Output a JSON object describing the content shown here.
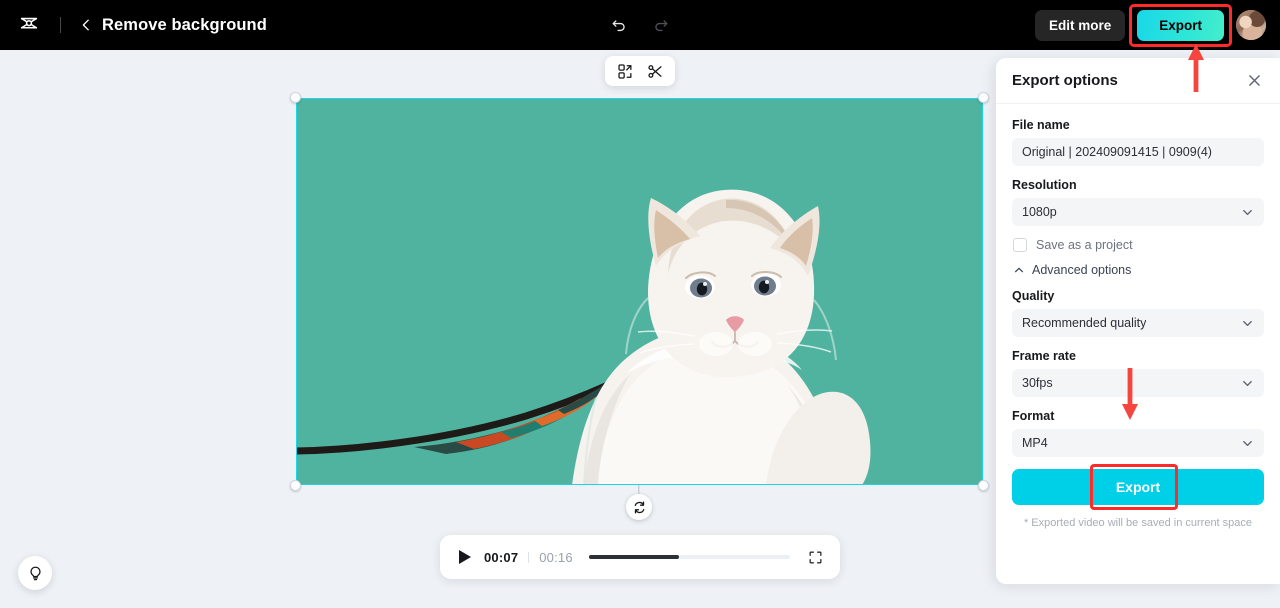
{
  "header": {
    "logo_icon": "capcut-logo-icon",
    "back_icon": "chevron-left-icon",
    "project_title": "Remove background",
    "undo_icon": "undo-icon",
    "redo_icon": "redo-icon",
    "edit_more_label": "Edit more",
    "export_label": "Export",
    "avatar_name": "user-avatar"
  },
  "toolchip": {
    "cutout_icon": "cutout-icon",
    "split_icon": "scissors-icon"
  },
  "canvas": {
    "background_color": "#4fb3a0",
    "selection_color": "#1fd4e8",
    "rotate_icon": "rotate-icon"
  },
  "player": {
    "play_icon": "play-icon",
    "current_time": "00:07",
    "total_time": "00:16",
    "progress_percent": 45,
    "fullscreen_icon": "fullscreen-icon"
  },
  "help": {
    "icon": "lightbulb-icon"
  },
  "panel": {
    "title": "Export options",
    "close_icon": "close-icon",
    "filename_label": "File name",
    "filename_value": "Original | 202409091415 | 0909(4)",
    "resolution_label": "Resolution",
    "resolution_value": "1080p",
    "save_project_label": "Save as a project",
    "save_project_checked": false,
    "advanced_label": "Advanced options",
    "quality_label": "Quality",
    "quality_value": "Recommended quality",
    "framerate_label": "Frame rate",
    "framerate_value": "30fps",
    "format_label": "Format",
    "format_value": "MP4",
    "export_button_label": "Export",
    "note": "* Exported video will be saved in current space"
  },
  "annotations": {
    "highlight_color": "#ff2b28",
    "arrow_up_target": "header-export-button",
    "arrow_down_target": "panel-export-button"
  },
  "colors": {
    "header_bg": "#000000",
    "workspace_bg": "#eef1f5",
    "accent_cyan": "#00cfe8",
    "panel_bg": "#ffffff"
  }
}
